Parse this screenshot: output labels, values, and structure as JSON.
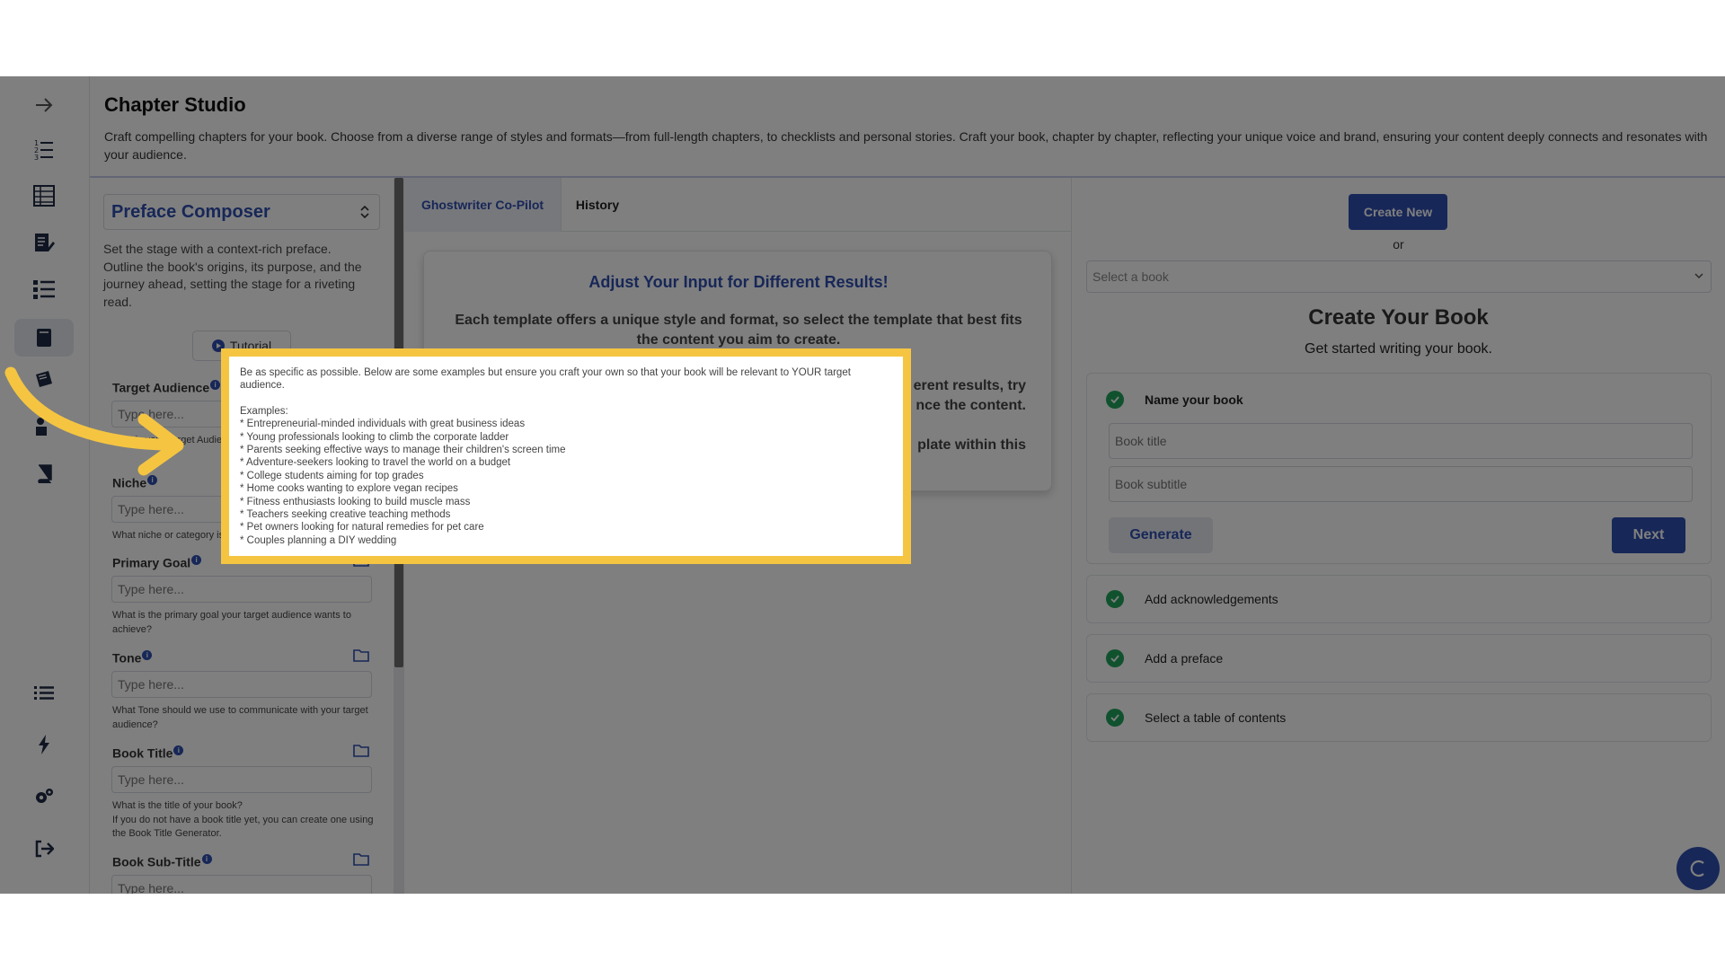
{
  "header": {
    "title": "Chapter Studio",
    "description": "Craft compelling chapters for your book. Choose from a diverse range of styles and formats—from full-length chapters, to checklists and personal stories. Craft your book, chapter by chapter, reflecting your unique voice and brand, ensuring your content deeply connects and resonates with your audience."
  },
  "sidebar": {
    "icons": [
      "expand-arrow-icon",
      "numbered-list-icon",
      "table-icon",
      "edit-document-icon",
      "list-icon",
      "book-editor-icon",
      "books-icon",
      "person-book-icon",
      "closed-book-icon",
      "list-lines-icon",
      "bolt-icon",
      "gears-icon",
      "logout-icon"
    ]
  },
  "left_panel": {
    "template_name": "Preface Composer",
    "template_description": "Set the stage with a context-rich preface. Outline the book's origins, its purpose, and the journey ahead, setting the stage for a riveting read.",
    "tutorial_label": "Tutorial",
    "fields": [
      {
        "label": "Target Audience",
        "placeholder": "Type here...",
        "help": "Who is your Target Audience?"
      },
      {
        "label": "Niche",
        "placeholder": "Type here...",
        "help": "What niche or category is your book in?"
      },
      {
        "label": "Primary Goal",
        "placeholder": "Type here...",
        "help": "What is the primary goal your target audience wants to achieve?"
      },
      {
        "label": "Tone",
        "placeholder": "Type here...",
        "help": "What Tone should we use to communicate with your target audience?"
      },
      {
        "label": "Book Title",
        "placeholder": "Type here...",
        "help": "What is the title of your book?\nIf you do not have a book title yet, you can create one using the Book Title Generator."
      },
      {
        "label": "Book Sub-Title",
        "placeholder": "Type here...",
        "help": ""
      }
    ]
  },
  "middle_panel": {
    "tabs": [
      "Ghostwriter Co-Pilot",
      "History"
    ],
    "card_title": "Adjust Your Input for Different Results!",
    "card_text_1": "Each template offers a unique style and format, so select the template that best fits the content you aim to create.",
    "card_text_2": "erent results, try",
    "card_text_3": "nce the content.",
    "card_text_4": "plate within this"
  },
  "right_panel": {
    "create_new_label": "Create New",
    "or_label": "or",
    "book_select_placeholder": "Select a book",
    "title": "Create Your Book",
    "subtitle": "Get started writing your book.",
    "step_name_label": "Name your book",
    "book_title_placeholder": "Book title",
    "book_subtitle_placeholder": "Book subtitle",
    "generate_label": "Generate",
    "next_label": "Next",
    "steps": [
      "Add acknowledgements",
      "Add a preface",
      "Select a table of contents"
    ]
  },
  "tooltip": {
    "intro": "Be as specific as possible. Below are some examples but ensure you craft your own so that your book will be relevant to YOUR target audience.",
    "examples_heading": "Examples:",
    "examples": [
      "* Entrepreneurial-minded individuals with great business ideas",
      "* Young professionals looking to climb the corporate ladder",
      "* Parents seeking effective ways to manage their children's screen time",
      "* Adventure-seekers looking to travel the world on a budget",
      "* College students aiming for top grades",
      "* Home cooks wanting to explore vegan recipes",
      "* Fitness enthusiasts looking to build muscle mass",
      "* Teachers seeking creative teaching methods",
      "* Pet owners looking for natural remedies for pet care",
      "* Couples planning a DIY wedding"
    ]
  },
  "colors": {
    "accent": "#2f4fb0",
    "highlight_border": "#f5c542",
    "success": "#22a45d",
    "overlay": "rgba(0,0,0,0.5)"
  }
}
